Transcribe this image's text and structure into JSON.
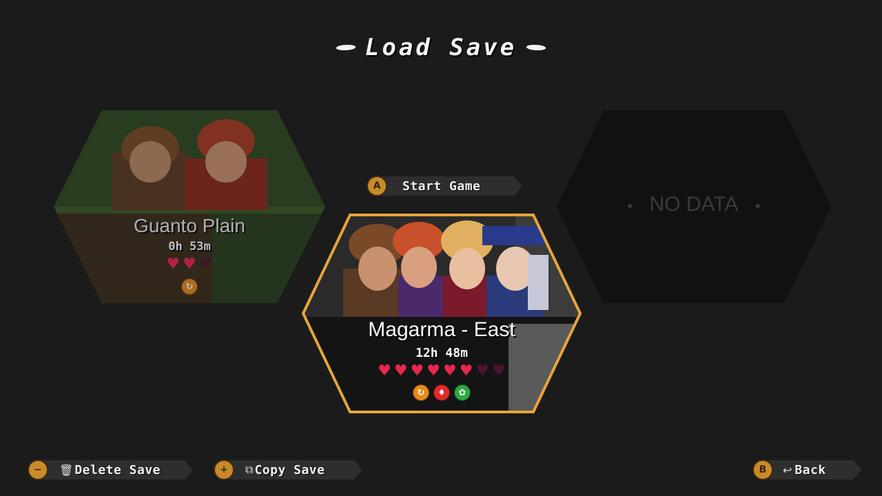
{
  "screen": {
    "title": "Load Save"
  },
  "start_game": {
    "button_glyph": "A",
    "label": "Start Game"
  },
  "slots": [
    {
      "location": "Guanto Plain",
      "playtime": "0h 53m",
      "hearts_full": 2,
      "hearts_total": 3,
      "icons": [
        "orange-swirl-icon"
      ]
    },
    {
      "location": "Magarma - East",
      "playtime": "12h 48m",
      "hearts_full": 6,
      "hearts_total": 8,
      "icons": [
        "orange-swirl-icon",
        "red-flame-icon",
        "green-leaf-icon"
      ],
      "selected": true
    },
    {
      "empty_label": "NO DATA"
    }
  ],
  "footer": {
    "delete": {
      "button_glyph": "−",
      "label": "Delete Save"
    },
    "copy": {
      "button_glyph": "+",
      "label": "Copy Save"
    },
    "back": {
      "button_glyph": "B",
      "label": "Back"
    }
  },
  "colors": {
    "background": "#1b1b1b",
    "selection_border": "#e8a43a",
    "heart_full": "#e8264f",
    "heart_empty": "#4a1530"
  }
}
